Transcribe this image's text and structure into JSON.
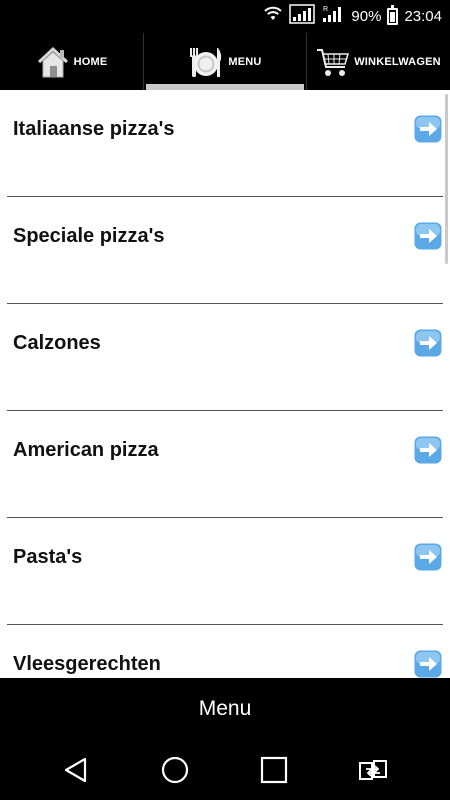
{
  "status_bar": {
    "battery_percent": "90%",
    "time": "23:04",
    "icons": [
      "wifi-icon",
      "signal-icon",
      "signal-roaming-icon",
      "battery-icon"
    ]
  },
  "tabs": [
    {
      "label": "HOME",
      "icon": "home-icon",
      "active": false
    },
    {
      "label": "MENU",
      "icon": "plate-cutlery-icon",
      "active": true
    },
    {
      "label": "WINKELWAGEN",
      "icon": "shopping-cart-icon",
      "active": false
    }
  ],
  "menu_items": [
    {
      "label": "Italiaanse pizza's",
      "icon": "arrow-right-icon"
    },
    {
      "label": "Speciale pizza's",
      "icon": "arrow-right-icon"
    },
    {
      "label": "Calzones",
      "icon": "arrow-right-icon"
    },
    {
      "label": "American pizza",
      "icon": "arrow-right-icon"
    },
    {
      "label": "Pasta's",
      "icon": "arrow-right-icon"
    },
    {
      "label": "Vleesgerechten",
      "icon": "arrow-right-icon"
    }
  ],
  "bottom_menu": {
    "label": "Menu"
  },
  "nav_bar": [
    "back-icon",
    "home-circle-icon",
    "recents-icon",
    "switch-app-icon"
  ],
  "colors": {
    "accent_arrow": "#5aa9e6",
    "active_tab_indicator": "#c9c9c9",
    "background": "#ffffff",
    "bars": "#000000"
  }
}
